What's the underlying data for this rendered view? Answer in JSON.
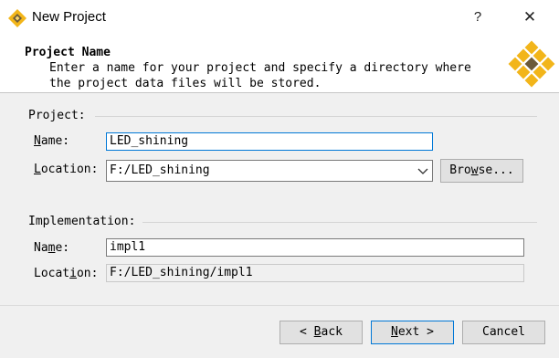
{
  "window": {
    "title": "New Project",
    "help_label": "?",
    "close_label": "✕"
  },
  "banner": {
    "title": "Project Name",
    "desc_line1": "Enter a name for your project and specify a directory where",
    "desc_line2": "the project data files will be stored."
  },
  "project_group": {
    "label": "Project:",
    "name_label_key": "N",
    "name_label_rest": "ame:",
    "name_value": "LED_shining",
    "location_label_key": "L",
    "location_label_rest": "ocation:",
    "location_value": "F:/LED_shining",
    "browse_key": "w",
    "browse_pre": "Bro",
    "browse_post": "se..."
  },
  "implementation_group": {
    "label": "Implementation:",
    "name_label_pre": "Na",
    "name_label_key": "m",
    "name_label_rest": "e:",
    "name_value": "impl1",
    "location_label_pre": "Locat",
    "location_label_key": "i",
    "location_label_rest": "on:",
    "location_value": "F:/LED_shining/impl1"
  },
  "footer": {
    "back_prefix": "< ",
    "back_key": "B",
    "back_rest": "ack",
    "next_key": "N",
    "next_rest": "ext >",
    "cancel_label": "Cancel"
  },
  "colors": {
    "accent": "#0078d7",
    "logo_gold": "#f2b51a",
    "logo_dark": "#6b5a3a"
  },
  "icons": {
    "app": "app-diamond-icon",
    "banner": "diamond-grid-logo-icon",
    "combo": "chevron-down-icon"
  }
}
